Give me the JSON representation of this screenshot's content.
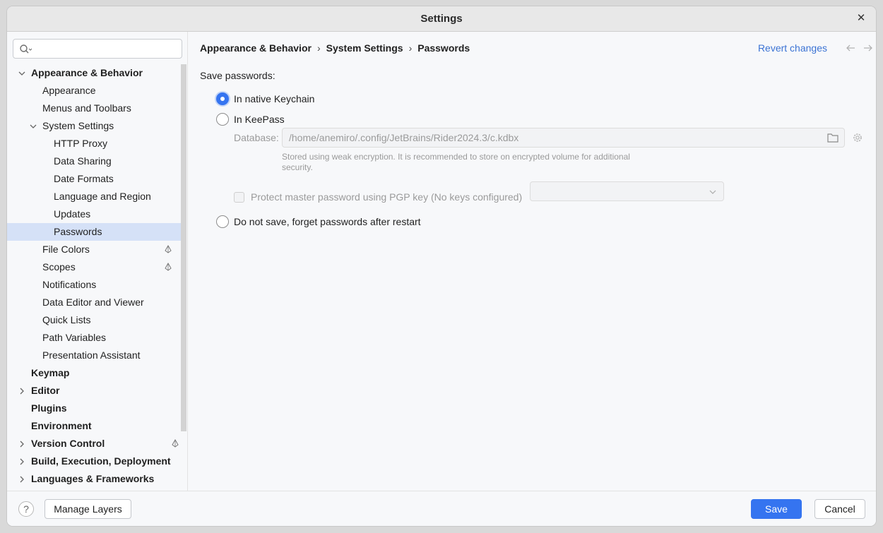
{
  "window": {
    "title": "Settings",
    "close_glyph": "✕"
  },
  "search": {
    "placeholder": "",
    "icon": "search-icon"
  },
  "sidebar": {
    "items": [
      {
        "label": "Appearance & Behavior"
      },
      {
        "label": "Appearance"
      },
      {
        "label": "Menus and Toolbars"
      },
      {
        "label": "System Settings"
      },
      {
        "label": "HTTP Proxy"
      },
      {
        "label": "Data Sharing"
      },
      {
        "label": "Date Formats"
      },
      {
        "label": "Language and Region"
      },
      {
        "label": "Updates"
      },
      {
        "label": "Passwords"
      },
      {
        "label": "File Colors"
      },
      {
        "label": "Scopes"
      },
      {
        "label": "Notifications"
      },
      {
        "label": "Data Editor and Viewer"
      },
      {
        "label": "Quick Lists"
      },
      {
        "label": "Path Variables"
      },
      {
        "label": "Presentation Assistant"
      },
      {
        "label": "Keymap"
      },
      {
        "label": "Editor"
      },
      {
        "label": "Plugins"
      },
      {
        "label": "Environment"
      },
      {
        "label": "Version Control"
      },
      {
        "label": "Build, Execution, Deployment"
      },
      {
        "label": "Languages & Frameworks"
      }
    ]
  },
  "breadcrumb": {
    "items": [
      "Appearance & Behavior",
      "System Settings",
      "Passwords"
    ],
    "separator": "›"
  },
  "header": {
    "revert_label": "Revert changes"
  },
  "passwords": {
    "section_label": "Save passwords:",
    "option_native": "In native Keychain",
    "option_keepass": "In KeePass",
    "database_label": "Database:",
    "database_value": "/home/anemiro/.config/JetBrains/Rider2024.3/c.kdbx",
    "hint": "Stored using weak encryption. It is recommended to store on encrypted volume for additional security.",
    "pgp_label": "Protect master password using PGP key (No keys configured)",
    "option_nosave": "Do not save, forget passwords after restart",
    "selected": "native"
  },
  "footer": {
    "help_glyph": "?",
    "manage_layers_label": "Manage Layers",
    "save_label": "Save",
    "cancel_label": "Cancel"
  },
  "colors": {
    "accent": "#3574f0",
    "link": "#3b73d4",
    "selected_bg": "#d5e1f7"
  }
}
